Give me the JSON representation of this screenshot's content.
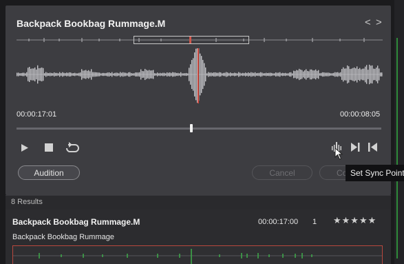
{
  "clip": {
    "title": "Backpack Bookbag Rummage.M",
    "prev_label": "<",
    "next_label": ">",
    "timecode_left": "00:00:17:01",
    "timecode_right": "00:00:08:05",
    "scrub_position": 0.48
  },
  "icons": {
    "play": "play-icon",
    "stop": "stop-icon",
    "loop": "loop-icon",
    "sync": "sync-point-icon",
    "next": "skip-forward-icon",
    "prev": "skip-back-icon"
  },
  "buttons": {
    "audition": "Audition",
    "cancel": "Cancel",
    "confirm_partial": "Co"
  },
  "tooltip": "Set Sync Point",
  "results": {
    "count_label": "8 Results",
    "items": [
      {
        "name": "Backpack Bookbag Rummage.M",
        "timecode": "00:00:17:00",
        "channels": "1",
        "rating": "★★★★★",
        "description": "Backpack Bookbag Rummage"
      }
    ]
  },
  "colors": {
    "panel_bg": "#3d3d41",
    "waveform": "#c7c7cb",
    "sync_marker": "#c9473d",
    "result_waveform": "#3fae4a"
  }
}
